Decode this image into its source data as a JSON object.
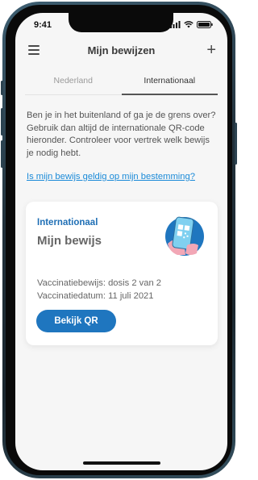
{
  "status_bar": {
    "time": "9:41"
  },
  "header": {
    "title": "Mijn bewijzen"
  },
  "tabs": [
    {
      "label": "Nederland"
    },
    {
      "label": "Internationaal"
    }
  ],
  "intro_text": "Ben je in het buitenland of ga je de grens over? Gebruik dan altijd de internationale QR-code hieronder. Controleer voor vertrek welk bewijs je nodig hebt.",
  "validity_link": "Is mijn bewijs geldig op mijn bestemming?",
  "card": {
    "kicker": "Internationaal",
    "title": "Mijn bewijs",
    "dose_line": "Vaccinatiebewijs: dosis 2 van 2",
    "date_line": "Vaccinatiedatum: 11 juli 2021",
    "button_label": "Bekijk QR"
  },
  "colors": {
    "accent": "#1f76bf",
    "kicker": "#1f6fb5",
    "link": "#1a8ad8",
    "background": "#f6f6f6"
  },
  "icons": [
    "menu-icon",
    "plus-icon",
    "signal-icon",
    "wifi-icon",
    "battery-icon",
    "phone-qr-illustration"
  ]
}
